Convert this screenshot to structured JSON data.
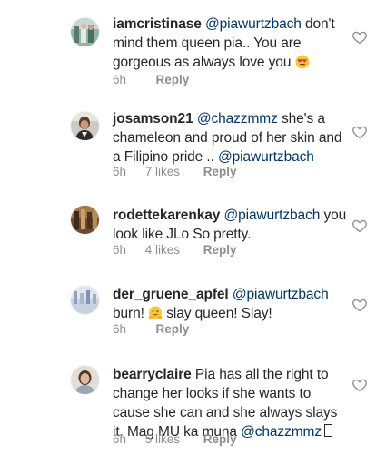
{
  "comments": [
    {
      "username": "iamcristinase",
      "mention": "@piawurtzbach",
      "text_before": " don't mind them queen pia.. You are gorgeous as always love you",
      "emoji": "smiling-face-with-heart-eyes",
      "time": "6h",
      "likes": "",
      "reply": "Reply"
    },
    {
      "username": "josamson21",
      "mention": "@chazzmmz",
      "text_before": " she's a chameleon and proud of her skin and a Filipino pride .. ",
      "mention2": "@piawurtzbach",
      "time": "6h",
      "likes": "7 likes",
      "reply": "Reply"
    },
    {
      "username": "rodettekarenkay",
      "mention": "@piawurtzbach",
      "text_before": "  you look like JLo So pretty.",
      "time": "6h",
      "likes": "4 likes",
      "reply": "Reply"
    },
    {
      "username": "der_gruene_apfel",
      "mention": "@piawurtzbach",
      "text_line2_a": "burn! ",
      "text_line2_b": " slay queen! Slay!",
      "emoji": "hugging-face",
      "time": "6h",
      "likes": "",
      "reply": "Reply"
    },
    {
      "username": "bearryclaire",
      "text_before": " Pia has all the right to change her looks if she wants to cause she can and she always slays it. Mag MU ka muna ",
      "mention": "@chazzmmz",
      "time": "6h",
      "likes": "5 likes",
      "reply": "Reply"
    }
  ],
  "colors": {
    "text": "#262626",
    "mention": "#003569",
    "meta": "#8e8e8e",
    "heart_stroke": "#8e8e8e"
  },
  "icons": {
    "like": "heart-outline-icon"
  }
}
